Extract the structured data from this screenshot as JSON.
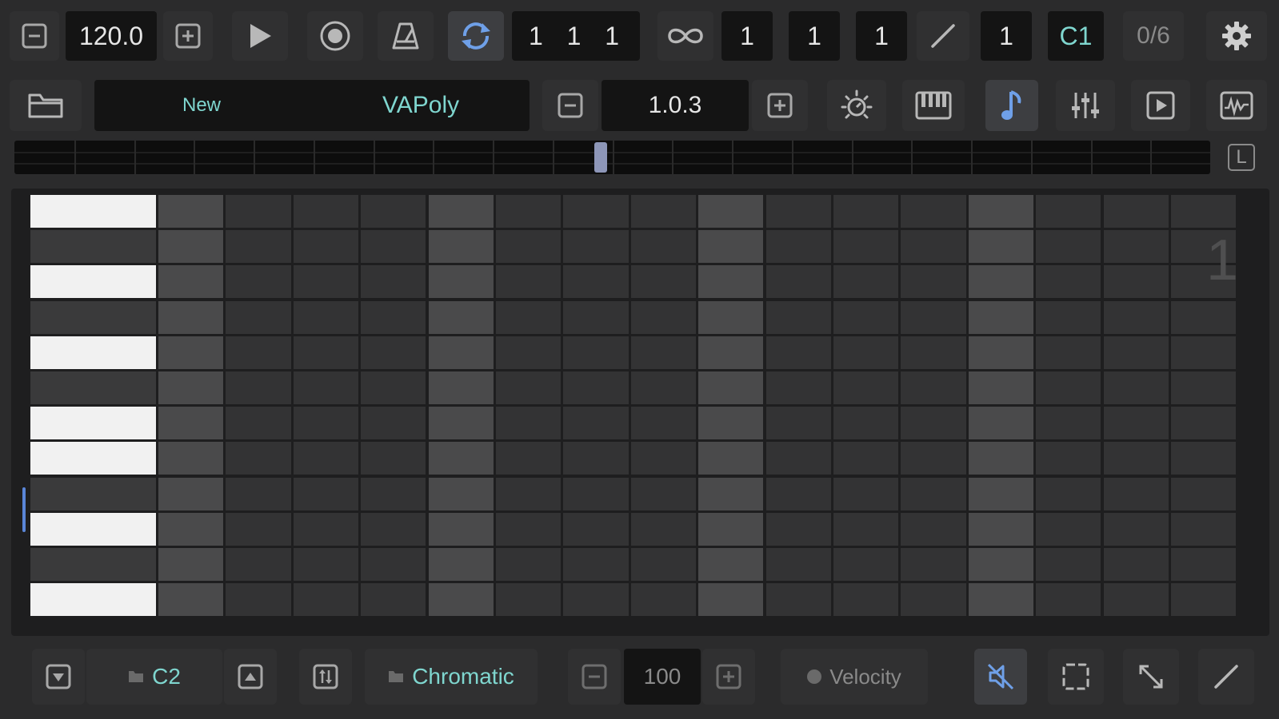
{
  "transport": {
    "tempo": "120.0",
    "position": "1  1  1",
    "loop_count": "1",
    "length_bars": "1",
    "length_beats": "1",
    "slash_value": "1",
    "root_note": "C1",
    "counter": "0/6"
  },
  "instrument_bar": {
    "preset_bank": "New",
    "preset_name": "VAPoly",
    "version": "1.0.3"
  },
  "timeline": {
    "loop_button": "L",
    "playhead_position": 0.49
  },
  "grid": {
    "pattern_number": "1",
    "rows": 12,
    "steps": 16,
    "keys": [
      "white",
      "black",
      "white",
      "black",
      "white",
      "black",
      "white",
      "white",
      "black",
      "white",
      "black",
      "white"
    ]
  },
  "bottom_bar": {
    "octave_note": "C2",
    "scale": "Chromatic",
    "velocity_value": "100",
    "velocity_label": "Velocity"
  },
  "colors": {
    "background": "#2b2b2c",
    "display": "#141414",
    "accent_teal": "#7fd6cf",
    "accent_blue": "#6fa0e8",
    "playhead": "#8d96b8"
  },
  "icons": {
    "top": [
      "minus-icon",
      "plus-icon",
      "play-icon",
      "record-icon",
      "metronome-icon",
      "loop-icon",
      "infinity-icon",
      "slash-icon",
      "gear-icon"
    ],
    "second": [
      "folder-icon",
      "minus-icon",
      "plus-icon",
      "sun-icon",
      "piano-icon",
      "note-icon",
      "mixer-icon",
      "play-square-icon",
      "waveform-icon"
    ],
    "bottom": [
      "arrow-down-icon",
      "arrow-up-icon",
      "transpose-icon",
      "minus-icon",
      "plus-icon",
      "mute-icon",
      "select-icon",
      "expand-icon",
      "pencil-icon"
    ]
  }
}
